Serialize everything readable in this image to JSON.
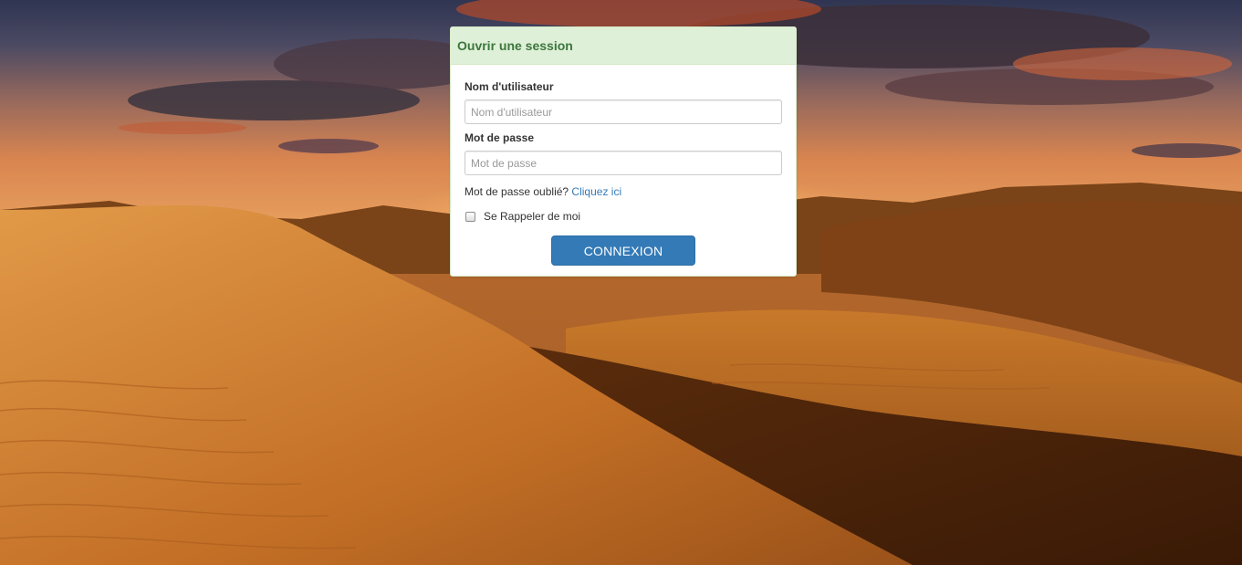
{
  "login": {
    "title": "Ouvrir une session",
    "username_label": "Nom d'utilisateur",
    "username_placeholder": "Nom d'utilisateur",
    "username_value": "",
    "password_label": "Mot de passe",
    "password_placeholder": "Mot de passe",
    "password_value": "",
    "forgot_text": "Mot de passe oublié?",
    "forgot_link": "Cliquez ici",
    "remember_label": "Se Rappeler de moi",
    "remember_checked": false,
    "submit_label": "CONNEXION"
  },
  "colors": {
    "heading_bg": "#dff0d8",
    "heading_text": "#3c763d",
    "button_bg": "#337ab7",
    "link": "#337ab7"
  },
  "background": {
    "icon": "desert-dunes-sunset-image"
  }
}
